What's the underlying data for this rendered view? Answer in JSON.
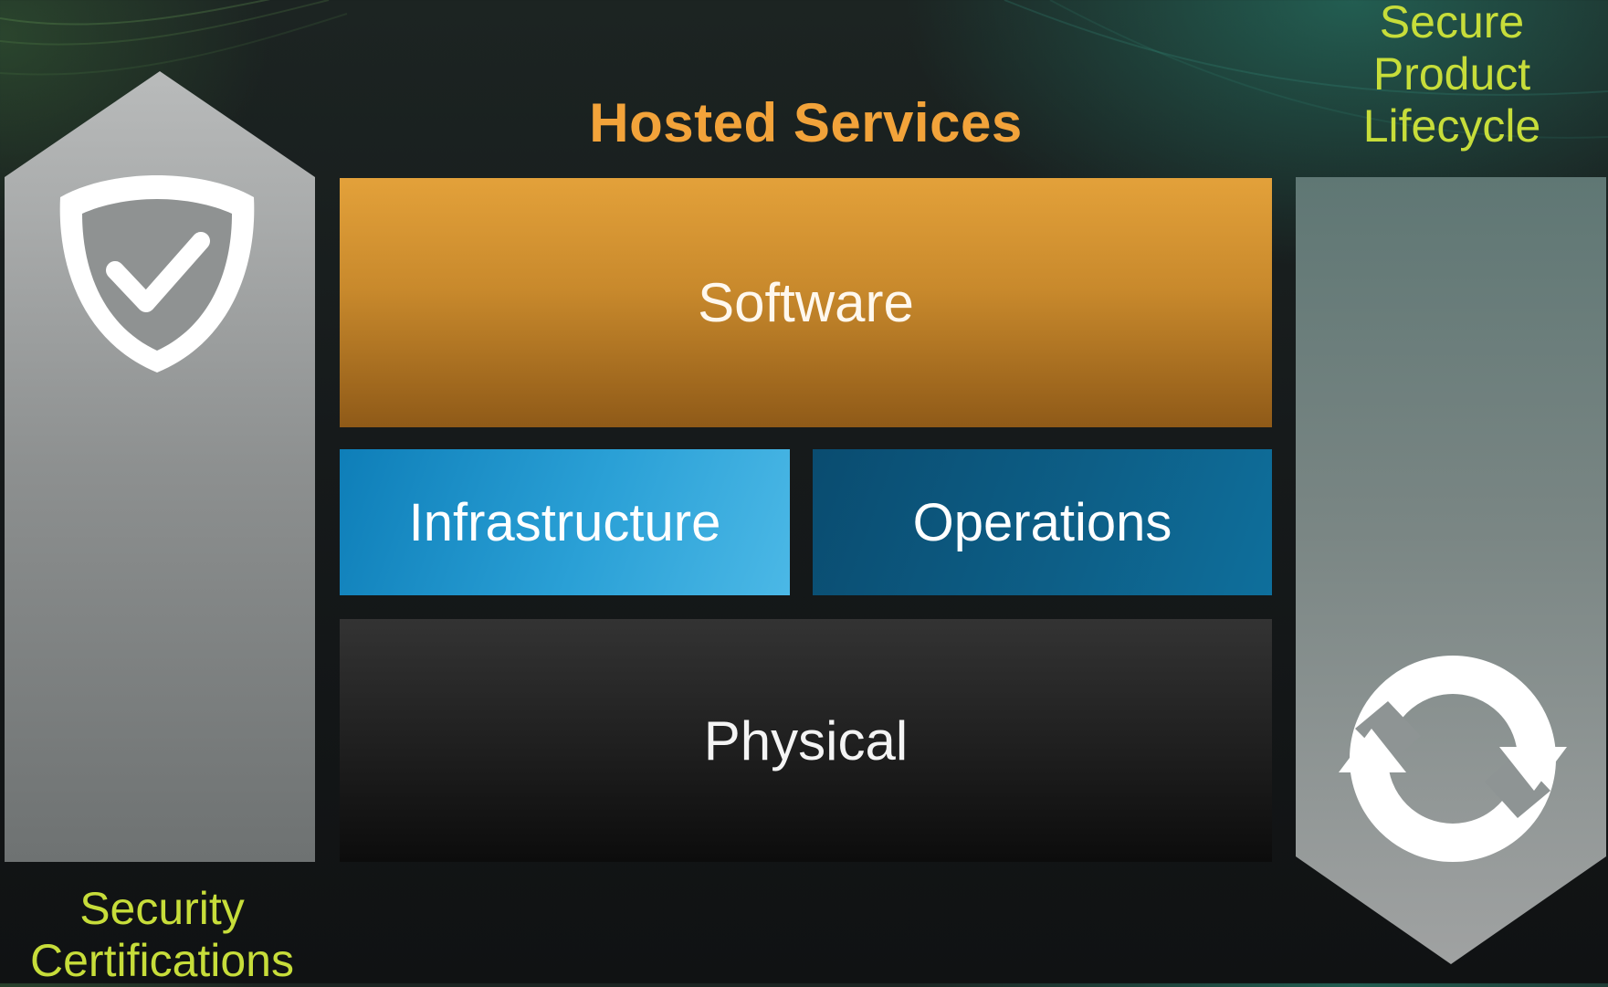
{
  "diagram": {
    "title": "Hosted Services",
    "layers": {
      "software": "Software",
      "infrastructure": "Infrastructure",
      "operations": "Operations",
      "physical": "Physical"
    },
    "left_pillar": {
      "label_line1": "Security",
      "label_line2": "Certifications",
      "icon": "shield-check-icon"
    },
    "right_pillar": {
      "label_line1": "Secure",
      "label_line2": "Product",
      "label_line3": "Lifecycle",
      "icon": "refresh-cycle-icon"
    }
  },
  "colors": {
    "title": "#f2a33a",
    "side_label": "#c7dd3a",
    "software": "#c8892c",
    "infrastructure": "#2aa0d6",
    "operations": "#0d5e86",
    "physical": "#1e1e1e",
    "pillar": "#9a9c9c"
  }
}
